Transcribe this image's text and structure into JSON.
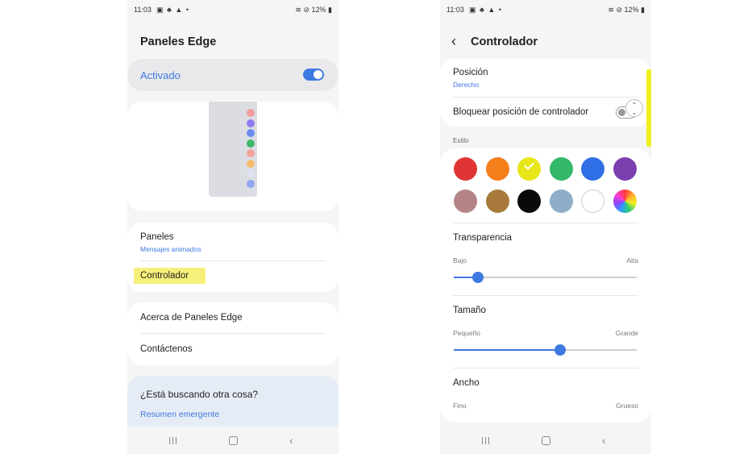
{
  "left_screen": {
    "status": {
      "time": "11:03",
      "battery": "12%"
    },
    "title": "Paneles Edge",
    "master_switch": {
      "label": "Activado",
      "on": true
    },
    "preview_dot_colors": [
      "#f29a9a",
      "#8d7cf2",
      "#6a8df0",
      "#3db86a",
      "#f2a29a",
      "#f6bd6a",
      "#dde3f0",
      "#8ea6f2"
    ],
    "menu_group_1": {
      "panels_label": "Paneles",
      "panels_value": "Mensajes animados",
      "handle_label": "Controlador",
      "highlight_color": "#f5f07a"
    },
    "menu_group_2": {
      "about_label": "Acerca de Paneles Edge",
      "contact_label": "Contáctenos"
    },
    "suggestion": {
      "question": "¿Está buscando otra cosa?",
      "link": "Resumen emergente"
    }
  },
  "right_screen": {
    "status": {
      "time": "11:03",
      "battery": "12%"
    },
    "title": "Controlador",
    "position": {
      "label": "Posición",
      "value": "Derecho"
    },
    "lock": {
      "label": "Bloquear posición de controlador",
      "on": false
    },
    "style_section_label": "Estilo",
    "selected_color_index": 2,
    "colors": [
      "#e03535",
      "#f47e1a",
      "#e6e619",
      "#33b86a",
      "#2f6fe6",
      "#7b3fb0",
      "#b58585",
      "#a87b3c",
      "#0a0a0a",
      "#8fadc8",
      "#ffffff",
      "multicolor"
    ],
    "transparency": {
      "label": "Transparencia",
      "min_label": "Bajo",
      "max_label": "Alta",
      "value": 0.13
    },
    "size": {
      "label": "Tamaño",
      "min_label": "Pequeño",
      "max_label": "Grande",
      "value": 0.58
    },
    "width": {
      "label": "Ancho",
      "min_label": "Fino",
      "max_label": "Grueso"
    },
    "edge_handle_color": "#f0f020"
  }
}
